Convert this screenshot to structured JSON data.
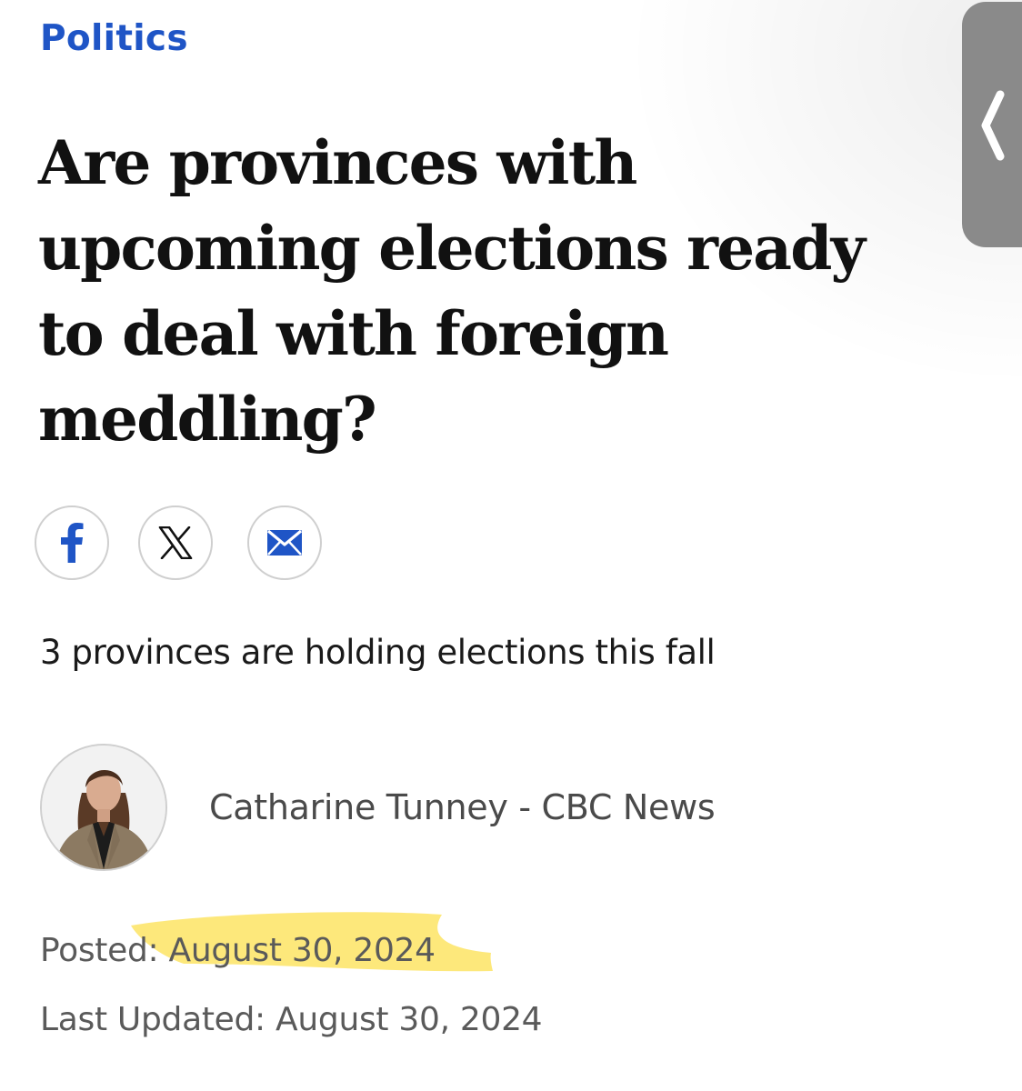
{
  "section": {
    "label": "Politics",
    "color": "#1f55c6"
  },
  "headline": "Are provinces with upcoming elections ready to deal with foreign meddling?",
  "share": {
    "buttons": [
      {
        "icon": "facebook-icon",
        "color": "#1f55c6"
      },
      {
        "icon": "x-icon",
        "color": "#111111"
      },
      {
        "icon": "mail-icon",
        "color": "#1f55c6"
      }
    ]
  },
  "sidebar_tab": {
    "icon": "chevron-left-icon"
  },
  "deck": "3 provinces are holding elections this fall",
  "byline": {
    "author_line": "Catharine Tunney - CBC News"
  },
  "dates": {
    "posted_label": "Posted:",
    "posted_date": "August 30, 2024",
    "updated_label": "Last Updated:",
    "updated_date": "August 30, 2024"
  },
  "highlight_color": "#fde25a"
}
